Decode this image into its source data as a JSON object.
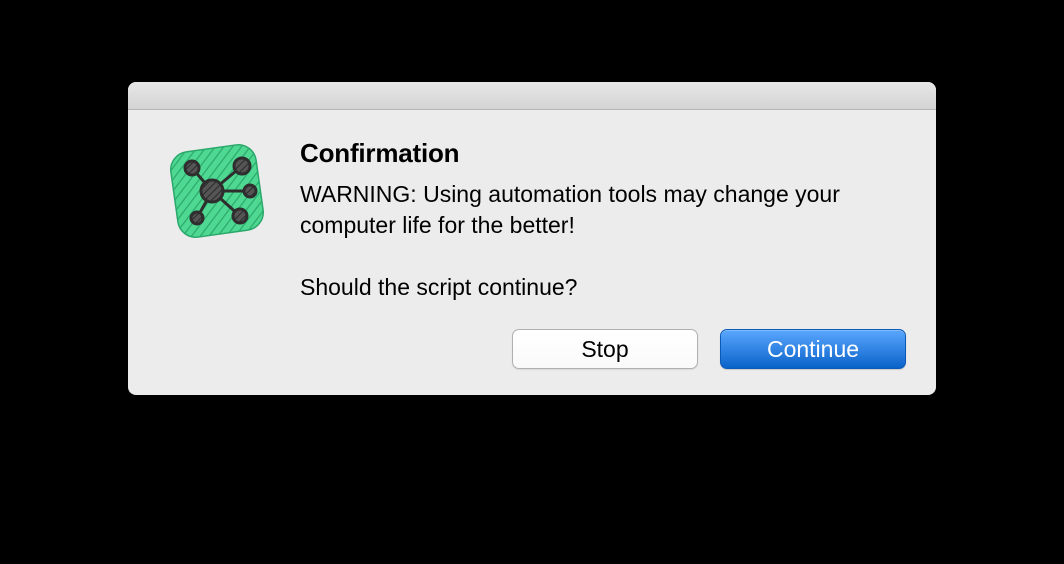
{
  "dialog": {
    "title": "Confirmation",
    "message": "WARNING: Using automation tools may change your computer life for the better!\n\nShould the script continue?",
    "buttons": {
      "secondary": "Stop",
      "primary": "Continue"
    }
  },
  "icon": {
    "name": "omnigraffle-app-icon",
    "accent": "#4fd891",
    "stroke": "#3a3a3a"
  }
}
